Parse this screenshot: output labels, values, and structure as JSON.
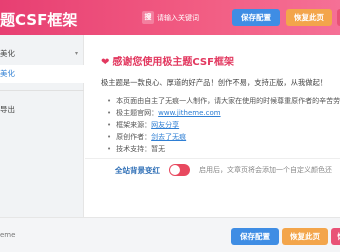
{
  "header": {
    "brand": "题CSF框架",
    "search_icon_label": "搜",
    "search_placeholder": "请输入关键词",
    "save_label": "保存配置",
    "reset_label": "恢复此页",
    "extra_label": "恢"
  },
  "sidebar": {
    "parent_label": "美化",
    "parent_caret": "▾",
    "active_label": "美化",
    "item_label": "导出"
  },
  "card": {
    "heart": "❤",
    "title": "感谢您使用极主题CSF框架",
    "intro": "极主题是一款良心、厚道的好产品！创作不易，支持正版，从我做起！",
    "list": [
      "本页面由自主了无痕一人制作，请大家在使用的时候尊重原作者的辛苦劳",
      "极主题官网：",
      "框架来源：",
      "原创作者：",
      "技术支持：暂无"
    ],
    "links": {
      "site": "www.jitheme.com",
      "source": "网友分享",
      "author": "剑去了无痕"
    }
  },
  "toggle": {
    "label": "全站背景变红",
    "help": "启用后，文章页将会添加一个自定义颜色还"
  },
  "footer": {
    "text": "eme",
    "save_label": "保存配置",
    "reset_label": "恢复此页",
    "extra_label": "恢"
  },
  "colors": {
    "header_gradient_start": "#e73f72",
    "header_gradient_end": "#f57096",
    "primary_blue": "#3f8de4",
    "orange": "#f3a54b",
    "pink": "#e2385f"
  }
}
